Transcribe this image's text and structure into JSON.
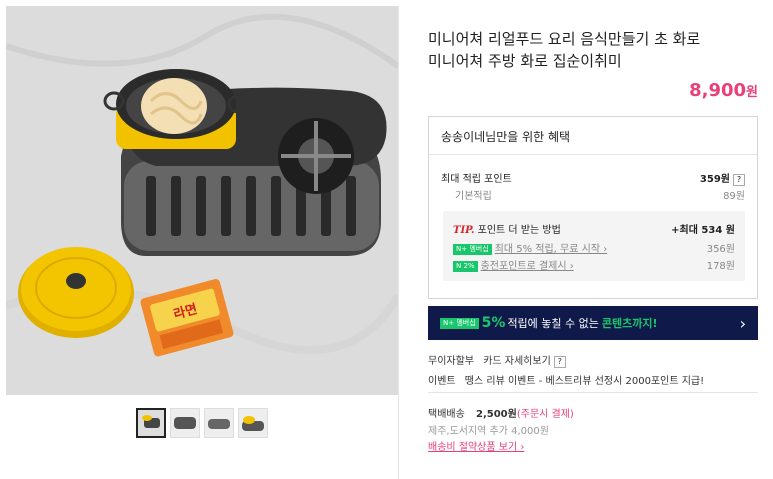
{
  "product": {
    "title_line1": "미니어쳐 리얼푸드 요리 음식만들기 초 화로",
    "title_line2": "미니어쳐 주방 화로 집순이취미",
    "price": "8,900",
    "price_unit": "원"
  },
  "benefit": {
    "header": "송송이네님만을 위한 혜택",
    "max_points_label": "최대 적립 포인트",
    "max_points_value": "359원",
    "basic_label": "기본적립",
    "basic_value": "89원",
    "tip_prefix": "TIP.",
    "tip_label": "포인트 더 받는 방법",
    "tip_value": "+최대 534 원",
    "tip_items": [
      {
        "badge": "N+ 멤버십",
        "label": "최대 5% 적립, 무료 시작 ›",
        "value": "356원"
      },
      {
        "badge": "N 2%",
        "label": "충전포인트로 결제시 ›",
        "value": "178원"
      }
    ]
  },
  "banner": {
    "badge": "N+ 멤버십",
    "pct": "5%",
    "text1": "적립에 놓칠 수 없는",
    "text2": "콘텐츠까지!",
    "arrow": "›"
  },
  "info": {
    "installment": "무이자할부",
    "card_detail": "카드 자세히보기",
    "event_label": "이벤트",
    "event_text": "땡스 리뷰 이벤트 - 베스트리뷰 선정시 2000포인트 지급!",
    "shipping_label": "택배배송",
    "shipping_price": "2,500원",
    "shipping_note": "(주문시 결제)",
    "extra_fee": "제주,도서지역 추가 4,000원",
    "save_link": "배송비 절약상품 보기 ›"
  },
  "colors": {
    "accent": "#e8407a",
    "banner_bg": "#0f1a4a",
    "green": "#19c66b"
  },
  "icons": {
    "help": "?",
    "chevron": "›"
  }
}
